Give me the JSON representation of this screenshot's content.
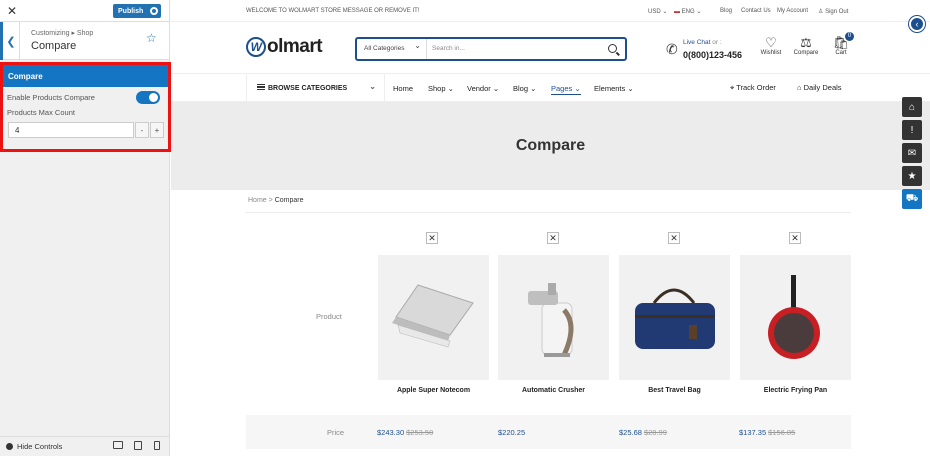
{
  "customizer": {
    "close_icon": "close-icon",
    "publish_label": "Publish",
    "breadcrumb": "Customizing ▸ Shop",
    "title": "Compare",
    "section_title": "Compare",
    "enable_label": "Enable Products Compare",
    "enable_value": true,
    "max_count_label": "Products Max Count",
    "max_count_value": "4",
    "minus": "-",
    "plus": "+",
    "hide_controls": "Hide Controls",
    "accent_color": "#1476c2"
  },
  "topbar": {
    "welcome": "WELCOME TO WOLMART STORE MESSAGE OR REMOVE IT!",
    "currency": "USD",
    "language": "ENG",
    "links": [
      "Blog",
      "Contact Us",
      "My Account",
      "Sign Out"
    ]
  },
  "header": {
    "logo_mark": "W",
    "logo_text": "olmart",
    "search_category": "All Categories",
    "search_placeholder": "Search in...",
    "live_chat": "Live Chat",
    "live_chat_or": "or :",
    "phone": "0(800)123-456",
    "wishlist": "Wishlist",
    "compare": "Compare",
    "cart": "Cart",
    "cart_count": "0"
  },
  "nav": {
    "browse": "BROWSE CATEGORIES",
    "items": [
      "Home",
      "Shop",
      "Vendor",
      "Blog",
      "Pages",
      "Elements"
    ],
    "track_order": "Track Order",
    "daily_deals": "Daily Deals"
  },
  "page": {
    "title": "Compare",
    "breadcrumb_home": "Home",
    "breadcrumb_sep": ">",
    "breadcrumb_current": "Compare",
    "product_row_label": "Product",
    "price_row_label": "Price"
  },
  "products": [
    {
      "name": "Apple Super Notecom",
      "price": "$243.30",
      "old_price": "$253.50"
    },
    {
      "name": "Automatic Crusher",
      "price": "$220.25",
      "old_price": ""
    },
    {
      "name": "Best Travel Bag",
      "price": "$25.68",
      "old_price": "$28.99"
    },
    {
      "name": "Electric Frying Pan",
      "price": "$137.35",
      "old_price": "$156.85"
    }
  ]
}
